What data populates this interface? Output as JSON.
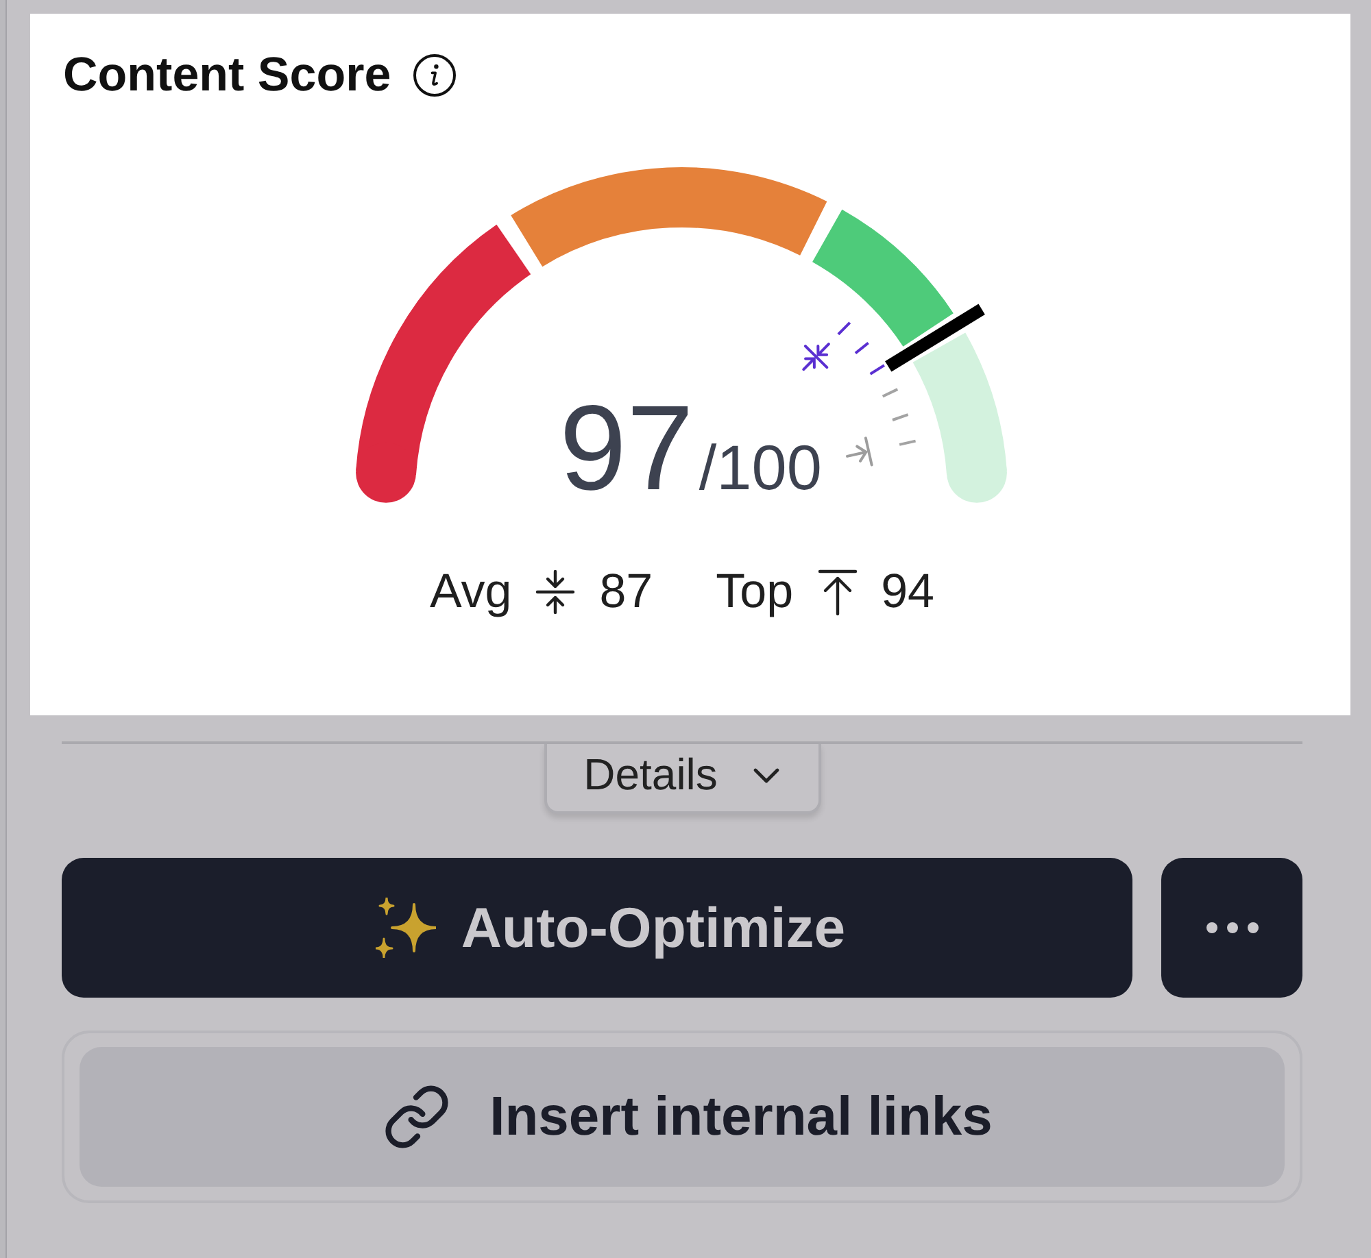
{
  "title": "Content Score",
  "gauge": {
    "level": 0.84,
    "segments": [
      {
        "color": "#dc2a41"
      },
      {
        "color": "#e5813a"
      },
      {
        "color": "#4ecb7a"
      }
    ],
    "markers": [
      {
        "kind": "avg"
      },
      {
        "kind": "top"
      }
    ],
    "score": "97",
    "max": "/100"
  },
  "stats": [
    {
      "kind": "avg",
      "label": "Avg",
      "value": "87"
    },
    {
      "kind": "top",
      "label": "Top",
      "value": "94"
    }
  ],
  "details": {
    "label": "Details",
    "expanded": false
  },
  "primary_button": {
    "label": "Auto-Optimize"
  },
  "secondary_button": {
    "label": "Insert internal links"
  }
}
